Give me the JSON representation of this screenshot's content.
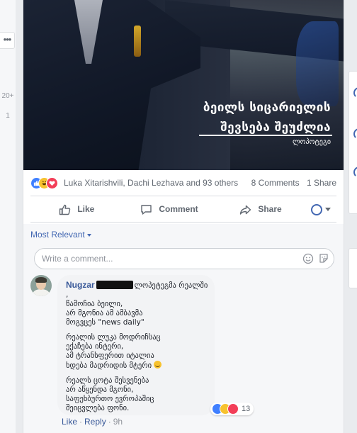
{
  "left_rail": {
    "more_label": "•••",
    "count_top": "20+",
    "count_bottom": "1"
  },
  "photo": {
    "headline_line1": "ბეილს სიცარიელის",
    "headline_line2": "შევსება შეუძლია",
    "headline_source": "ლოპოტეგი"
  },
  "reactions": {
    "names": "Luka Xitarishvili, Dachi Lezhava and 93 others",
    "comments": "8 Comments",
    "shares": "1 Share"
  },
  "actions": {
    "like": "Like",
    "comment": "Comment",
    "share": "Share"
  },
  "comments": {
    "sort_label": "Most Relevant",
    "composer_placeholder": "Write a comment...",
    "items": [
      {
        "author": "Nugzar",
        "first_line_tail": "ლოპეტეგმა რეალში ,",
        "para1_rest": "წამოჩია ბეილი,\nარ მგონია ამ ამბავმა\nმოგვცეს \"news daily\"",
        "para2": "რეალის ლუკა მოდრიჩსაც\nექაჩება ინტერი,\nამ ტრანსფერით იტალია\nხდება მადრიდის მტერი",
        "para3": "რეალს ცოტა შესვენება\nარ აწყენდა მგონი,\nსაფეხბურთო ევროპაშიც\nშეიცვლება ფონი.",
        "reaction_count": "13",
        "like_label": "Like",
        "reply_label": "Reply",
        "timestamp": "9h"
      }
    ]
  }
}
